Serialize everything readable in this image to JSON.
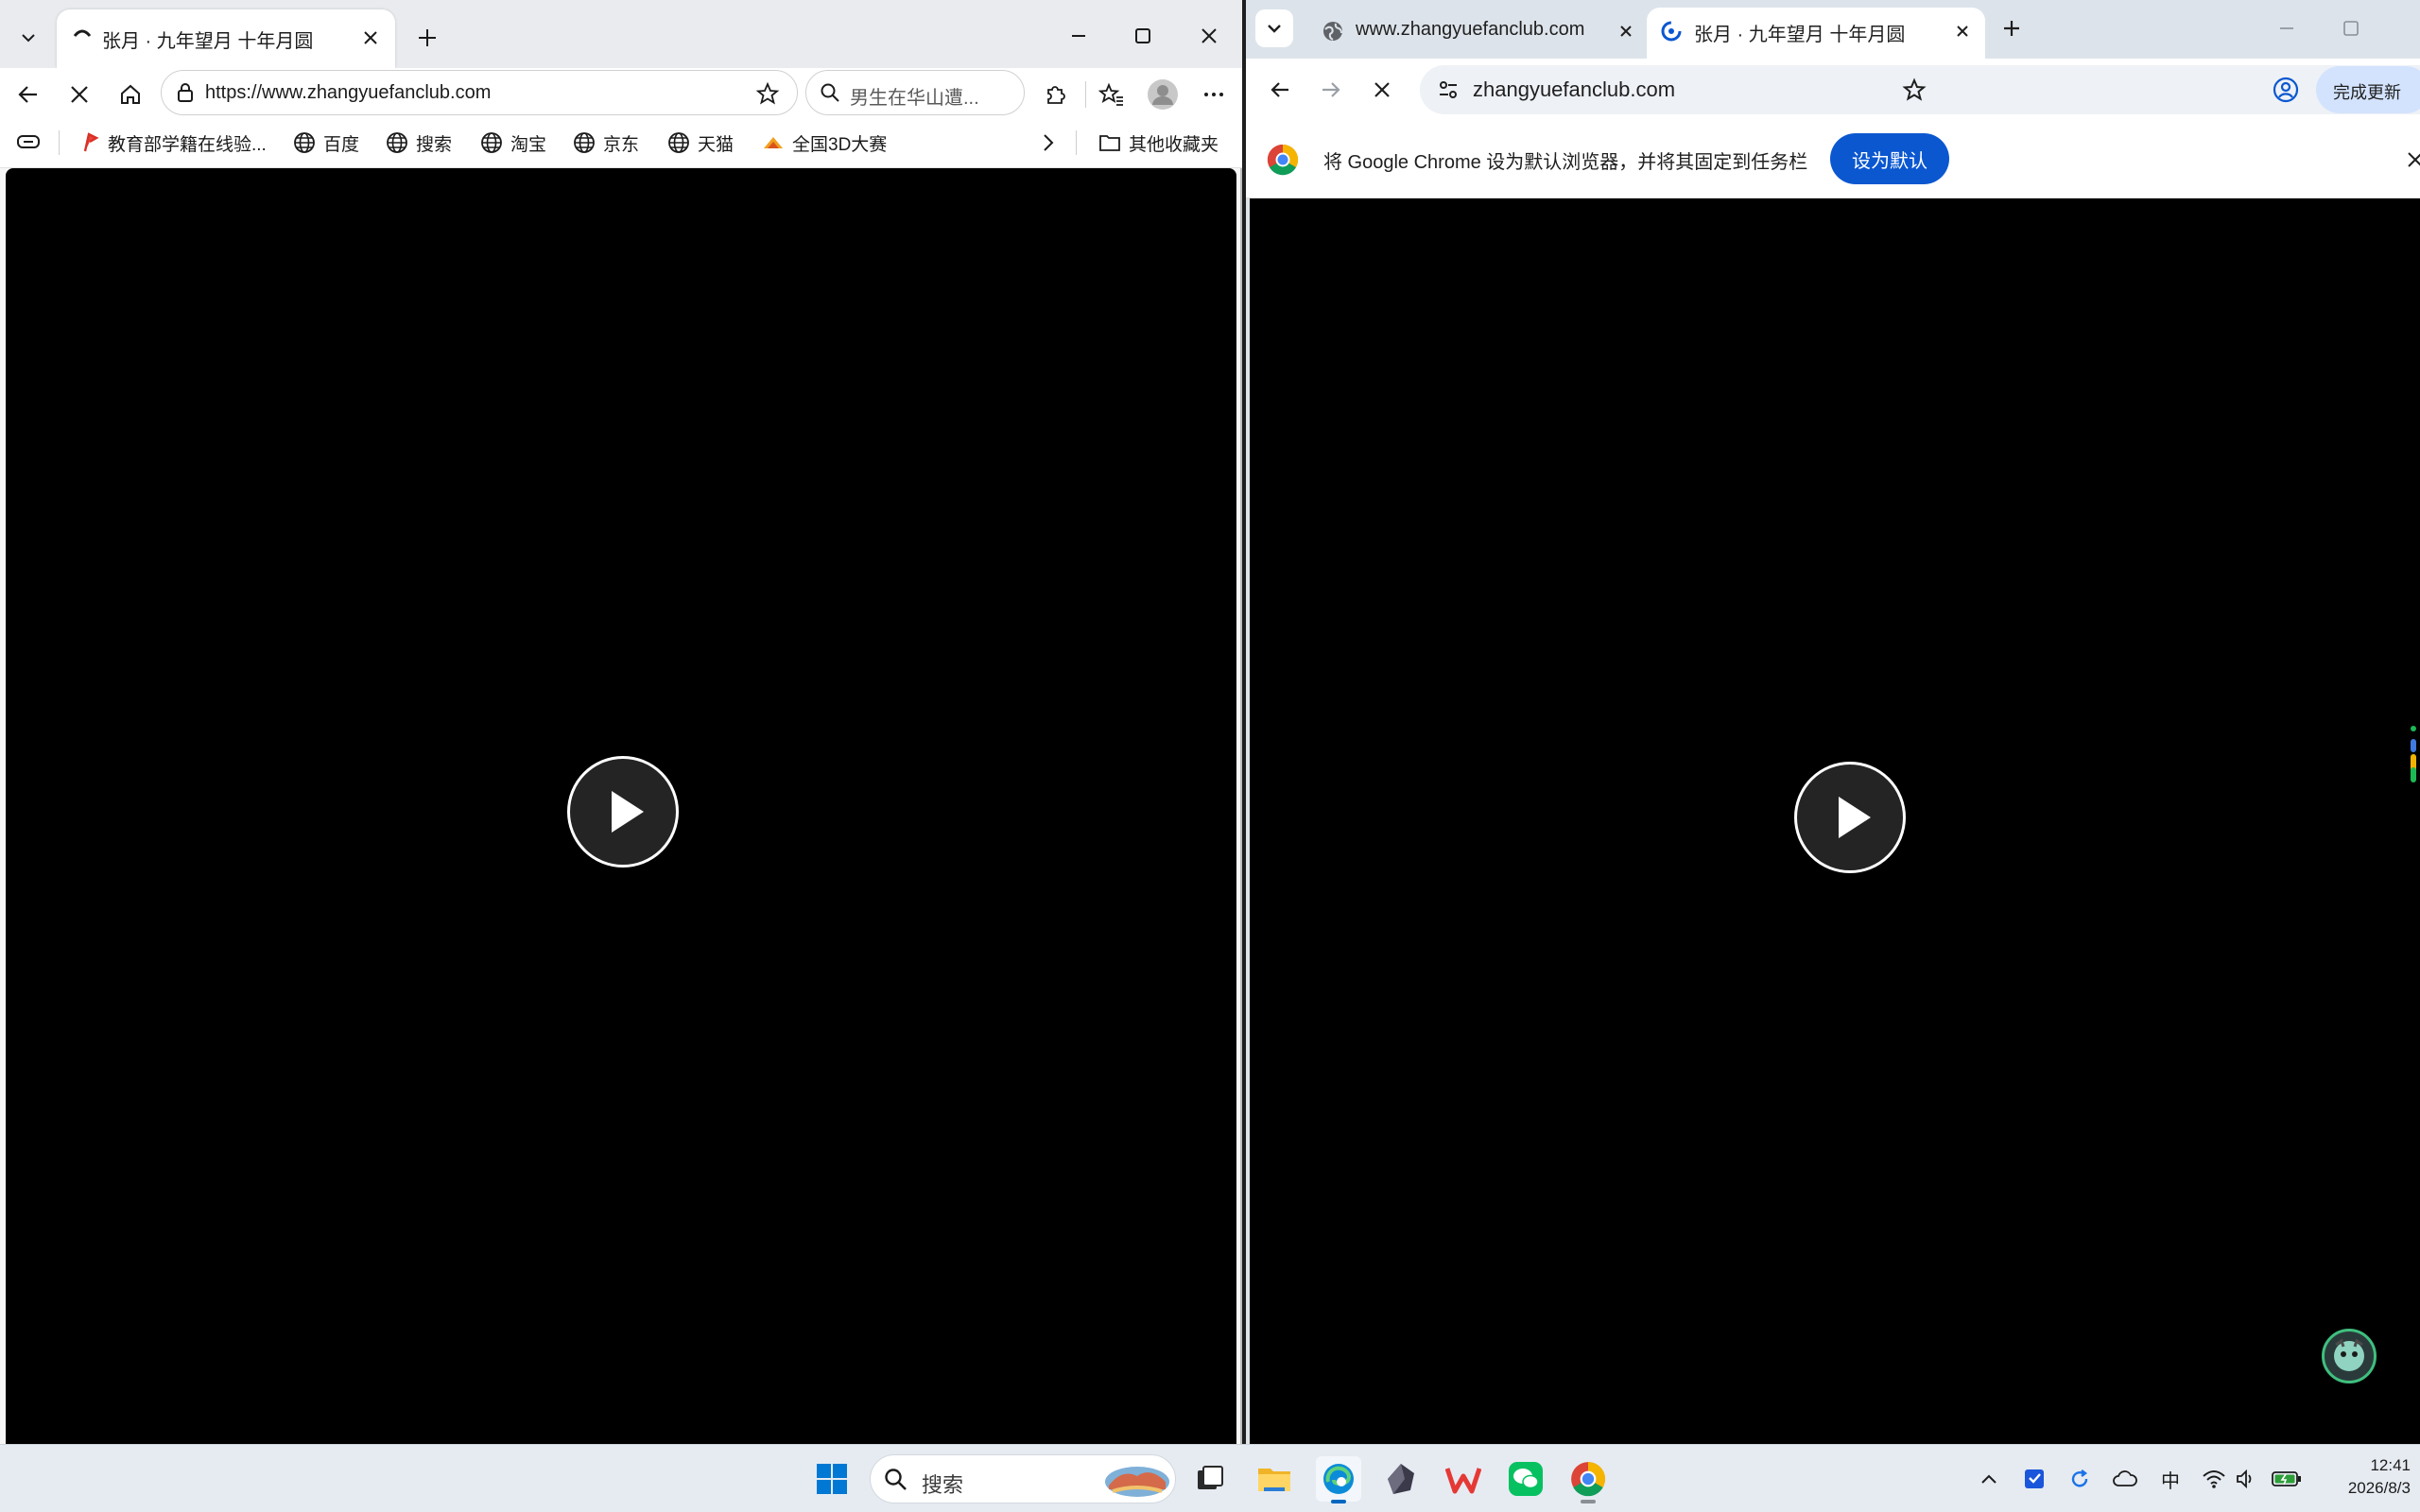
{
  "edge": {
    "tab_title": "张月 · 九年望月 十年月圆",
    "url": "https://www.zhangyuefanclub.com",
    "search_query": "男生在华山遭...",
    "bookmarks": [
      {
        "label": "教育部学籍在线验...",
        "icon": "flag-icon"
      },
      {
        "label": "百度",
        "icon": "globe-icon"
      },
      {
        "label": "搜索",
        "icon": "globe-icon"
      },
      {
        "label": "淘宝",
        "icon": "globe-icon"
      },
      {
        "label": "京东",
        "icon": "globe-icon"
      },
      {
        "label": "天猫",
        "icon": "globe-icon"
      },
      {
        "label": "全国3D大赛",
        "icon": "3d-icon"
      }
    ],
    "other_bookmarks": "其他收藏夹"
  },
  "chrome": {
    "tabs": [
      {
        "title": "www.zhangyuefanclub.com",
        "active": false
      },
      {
        "title": "张月 · 九年望月 十年月圆",
        "active": true
      }
    ],
    "url": "zhangyuefanclub.com",
    "update_label": "完成更新",
    "infobar": {
      "message": "将 Google Chrome 设为默认浏览器，并将其固定到任务栏",
      "button": "设为默认"
    }
  },
  "taskbar": {
    "search_label": "搜索",
    "apps": [
      "windows-start",
      "search",
      "task-view",
      "file-explorer",
      "edge",
      "obsidian",
      "wps",
      "wechat",
      "chrome"
    ],
    "ime": "中",
    "time": "12:41",
    "date": "2026/8/3"
  },
  "colors": {
    "edge_chrome_bg": "#e9ebee",
    "chrome_accent": "#0b57d0",
    "video_bg": "#000000",
    "taskbar_bg": "#e6ebf2"
  }
}
